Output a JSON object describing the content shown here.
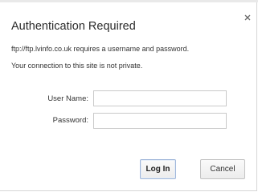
{
  "dialog": {
    "title": "Authentication Required",
    "message_line1": "ftp://ftp.lvinfo.co.uk requires a username and password.",
    "message_line2": "Your connection to this site is not private.",
    "close_icon": "close-icon"
  },
  "form": {
    "username_label": "User Name:",
    "username_value": "",
    "password_label": "Password:",
    "password_value": ""
  },
  "buttons": {
    "login_label": "Log In",
    "cancel_label": "Cancel"
  }
}
